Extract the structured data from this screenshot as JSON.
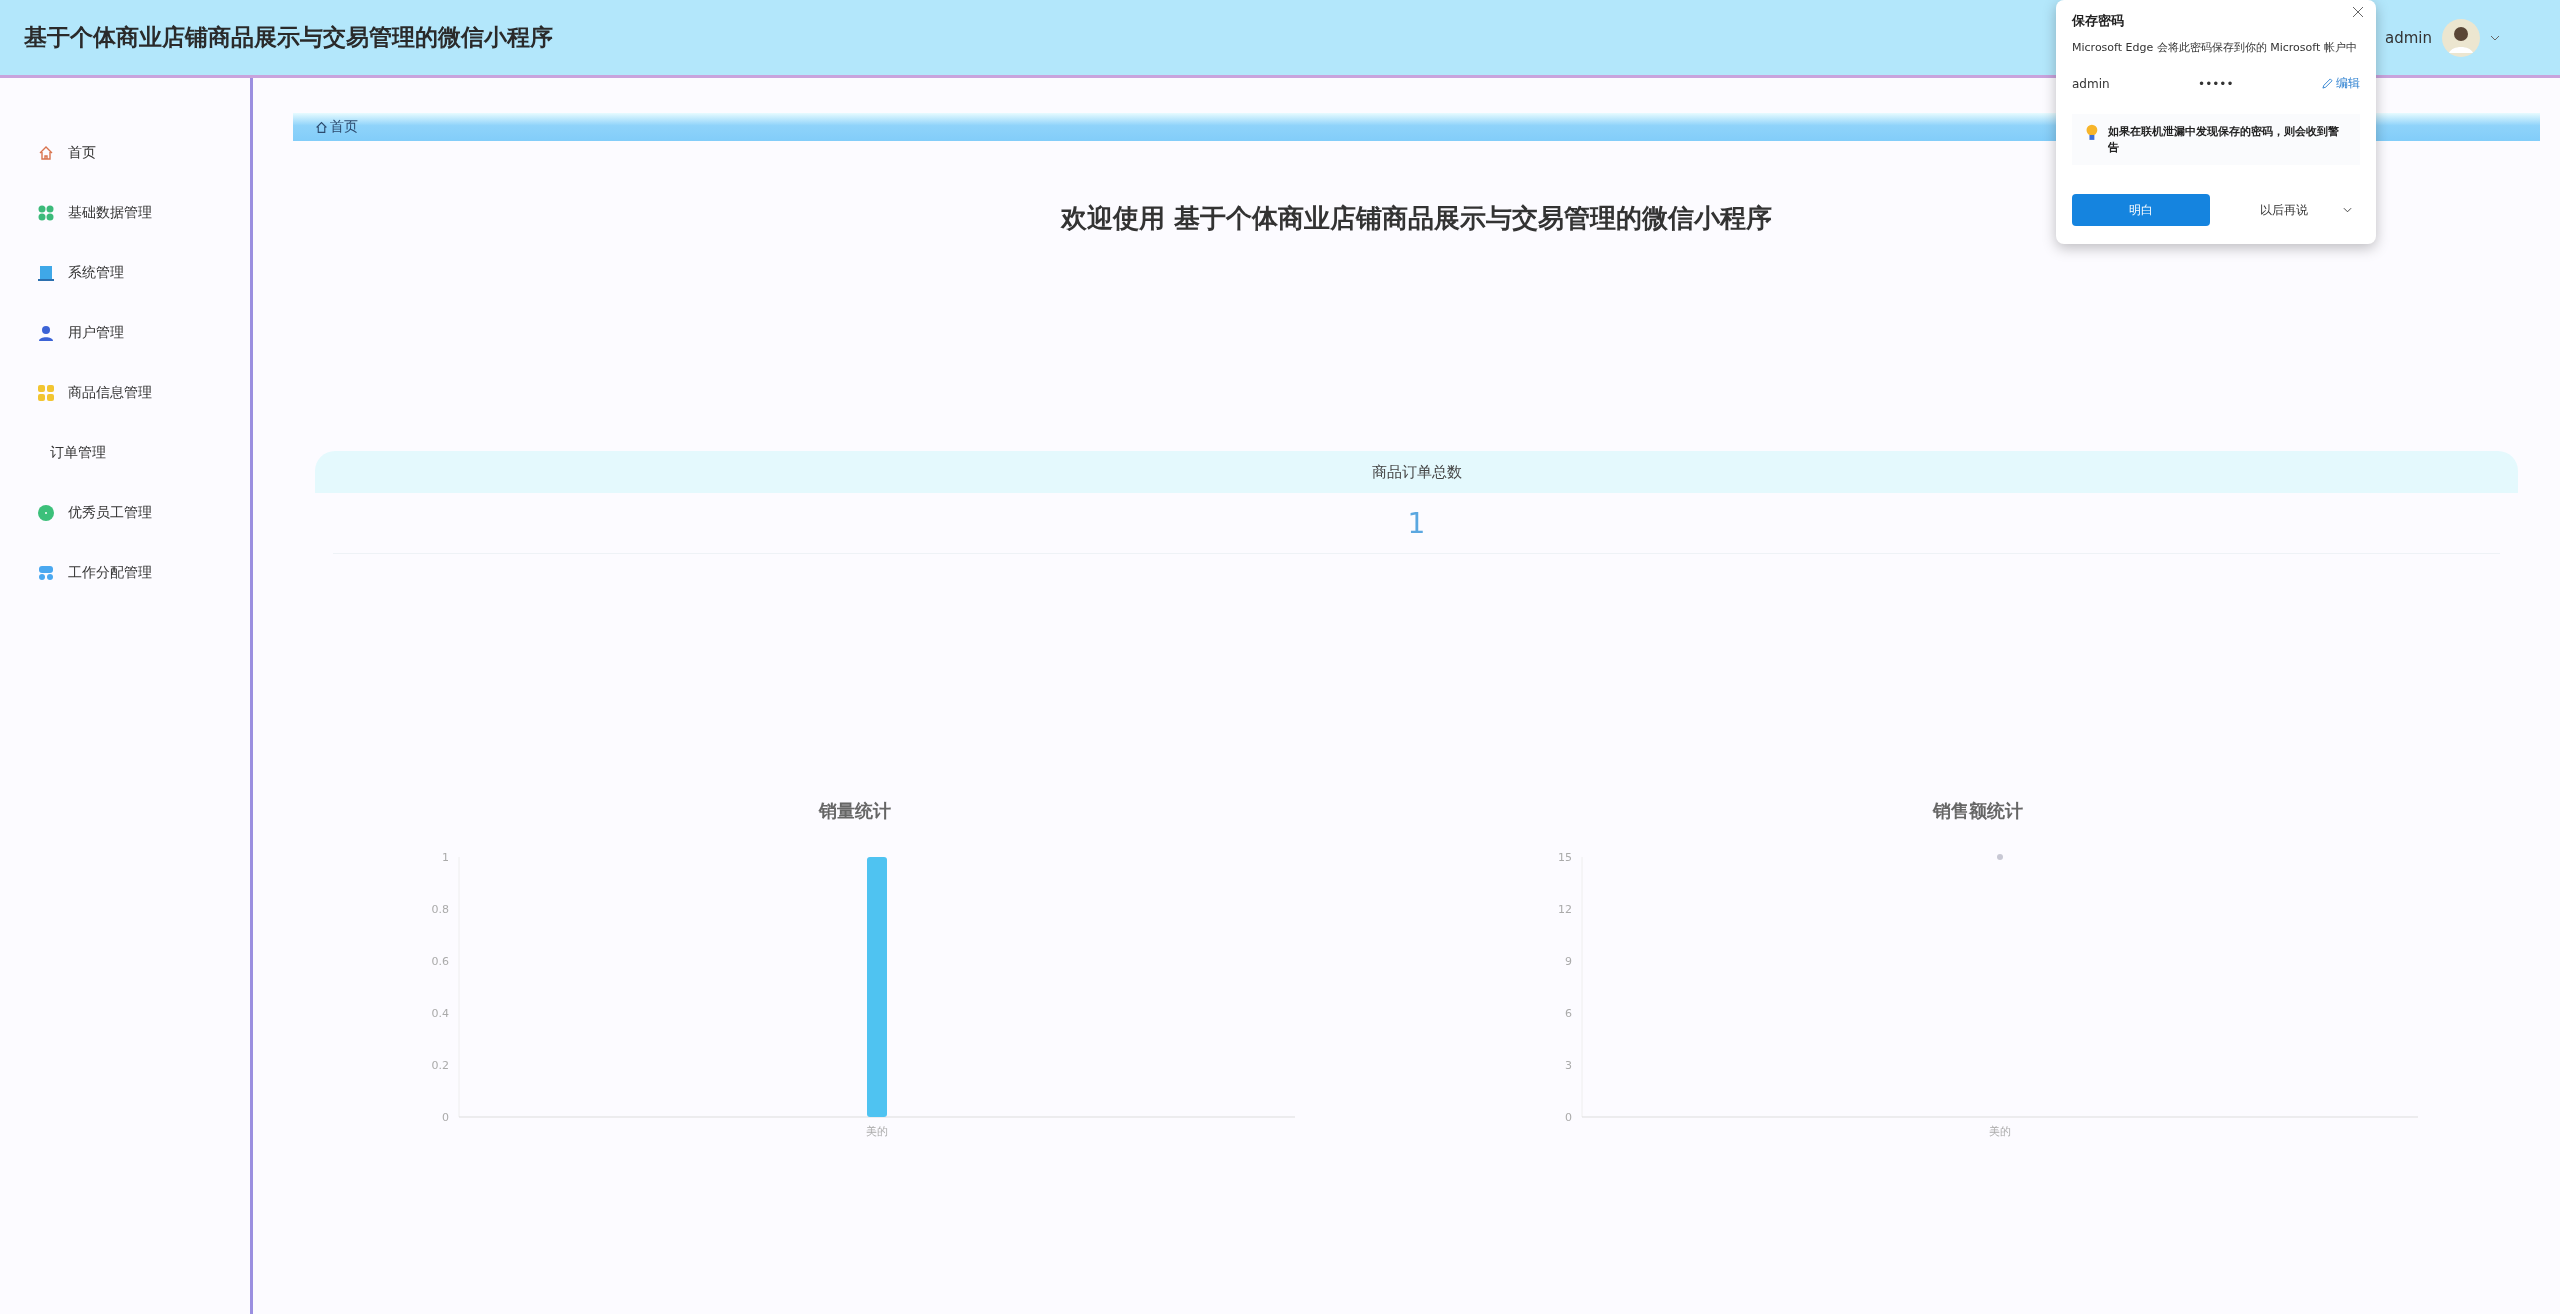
{
  "header": {
    "title": "基于个体商业店铺商品展示与交易管理的微信小程序",
    "user_greeting": "admin"
  },
  "sidebar": {
    "items": [
      {
        "label": "首页"
      },
      {
        "label": "基础数据管理"
      },
      {
        "label": "系统管理"
      },
      {
        "label": "用户管理"
      },
      {
        "label": "商品信息管理"
      },
      {
        "label": "订单管理"
      },
      {
        "label": "优秀员工管理"
      },
      {
        "label": "工作分配管理"
      }
    ]
  },
  "breadcrumb": {
    "label": "首页"
  },
  "welcome_title": "欢迎使用 基于个体商业店铺商品展示与交易管理的微信小程序",
  "stat_card": {
    "label": "商品订单总数",
    "value": "1"
  },
  "charts": [
    {
      "chart_data": {
        "type": "bar",
        "title": "销量统计",
        "categories": [
          "美的"
        ],
        "series": [
          {
            "color": "#4fc3f1",
            "values": [
              1
            ]
          }
        ],
        "ylim": [
          0,
          1
        ],
        "yticks": [
          0,
          0.2,
          0.4,
          0.6,
          0.8,
          1
        ]
      }
    },
    {
      "chart_data": {
        "type": "line",
        "title": "销售额统计",
        "categories": [
          "美的"
        ],
        "series": [
          {
            "color": "#c8c8d4",
            "values": [
              15
            ],
            "marker": "circle"
          }
        ],
        "ylim": [
          0,
          15
        ],
        "yticks": [
          0,
          3,
          6,
          9,
          12,
          15
        ]
      }
    }
  ],
  "password_popup": {
    "title": "保存密码",
    "description": "Microsoft Edge 会将此密码保存到你的 Microsoft 帐户中",
    "username": "admin",
    "password": "•••••",
    "edit_link": "编辑",
    "notice": "如果在联机泄漏中发现保存的密码，则会收到警告",
    "primary_button": "明白",
    "secondary_button": "以后再说"
  }
}
